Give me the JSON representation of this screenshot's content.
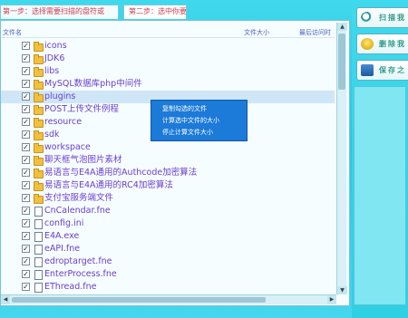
{
  "tabs": [
    {
      "label": "第一步：选择需要扫描的盘符或"
    },
    {
      "label": "第二步：选中你要删的"
    }
  ],
  "header": {
    "col_name": "文件名",
    "col_size": "文件大小",
    "col_time": "最后访问时"
  },
  "rows": [
    {
      "name": "icons",
      "type": "folder",
      "checked": true
    },
    {
      "name": "JDK6",
      "type": "folder",
      "checked": true
    },
    {
      "name": "libs",
      "type": "folder",
      "checked": true
    },
    {
      "name": "MySQL数据库php中间件",
      "type": "folder",
      "checked": true
    },
    {
      "name": "plugins",
      "type": "folder",
      "checked": true,
      "selected": true
    },
    {
      "name": "POST上传文件例程",
      "type": "folder",
      "checked": true
    },
    {
      "name": "resource",
      "type": "folder",
      "checked": true
    },
    {
      "name": "sdk",
      "type": "folder",
      "checked": true
    },
    {
      "name": "workspace",
      "type": "folder",
      "checked": true
    },
    {
      "name": "聊天框气泡图片素材",
      "type": "folder",
      "checked": true
    },
    {
      "name": "易语言与E4A通用的Authcode加密算法",
      "type": "folder",
      "checked": true
    },
    {
      "name": "易语言与E4A通用的RC4加密算法",
      "type": "folder",
      "checked": true
    },
    {
      "name": "支付宝服务端文件",
      "type": "folder",
      "checked": true
    },
    {
      "name": "CnCalendar.fne",
      "type": "file",
      "checked": true
    },
    {
      "name": "config.ini",
      "type": "file",
      "checked": true
    },
    {
      "name": "E4A.exe",
      "type": "file",
      "checked": true
    },
    {
      "name": "eAPI.fne",
      "type": "file",
      "checked": true
    },
    {
      "name": "edroptarget.fne",
      "type": "file",
      "checked": true
    },
    {
      "name": "EnterProcess.fne",
      "type": "file",
      "checked": true
    },
    {
      "name": "EThread.fne",
      "type": "file",
      "checked": true
    }
  ],
  "context_menu": [
    "复制勾选的文件",
    "计算选中文件的大小",
    "停止计算文件大小"
  ],
  "side_buttons": [
    {
      "label": "扫描我",
      "icon": "search-icon"
    },
    {
      "label": "删除我",
      "icon": "bulb-icon"
    },
    {
      "label": "保存之",
      "icon": "disk-icon"
    }
  ],
  "colors": {
    "link_text": "#6a3fd0",
    "menu_bg": "#1c7ad8",
    "bg": "#29c6e2"
  }
}
